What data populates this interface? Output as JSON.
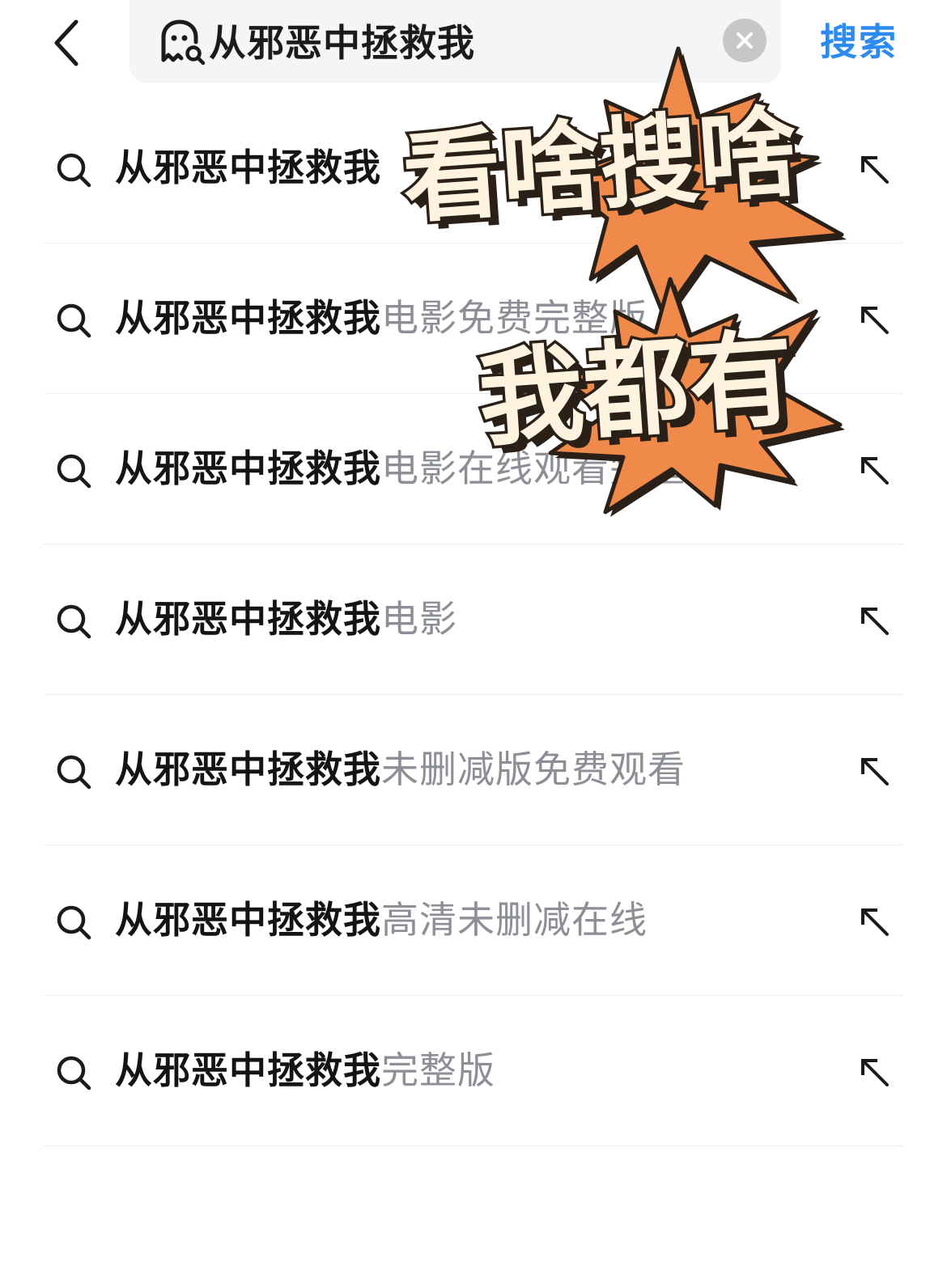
{
  "header": {
    "search": {
      "value": "从邪恶中拯救我"
    },
    "search_button_label": "搜索"
  },
  "suggestions": [
    {
      "query": "从邪恶中拯救我",
      "suffix": ""
    },
    {
      "query": "从邪恶中拯救我",
      "suffix": "电影免费完整版"
    },
    {
      "query": "从邪恶中拯救我",
      "suffix": "电影在线观看完整"
    },
    {
      "query": "从邪恶中拯救我",
      "suffix": "电影"
    },
    {
      "query": "从邪恶中拯救我",
      "suffix": "未删减版免费观看"
    },
    {
      "query": "从邪恶中拯救我",
      "suffix": "高清未删减在线"
    },
    {
      "query": "从邪恶中拯救我",
      "suffix": "完整版"
    }
  ],
  "overlay": {
    "line1": "看啥搜啥",
    "line2": "我都有",
    "burst_color": "#f08a4b",
    "text_color": "#fdf3de",
    "outline_color": "#2a2018"
  },
  "colors": {
    "accent": "#2d8bf0",
    "query_text": "#141414",
    "suffix_text": "#8c8f95"
  },
  "icons": {
    "back": "chevron-left-icon",
    "ghost": "ghost-search-icon",
    "clear": "close-circle-icon",
    "row_search": "search-icon",
    "row_fill": "arrow-up-left-icon"
  }
}
